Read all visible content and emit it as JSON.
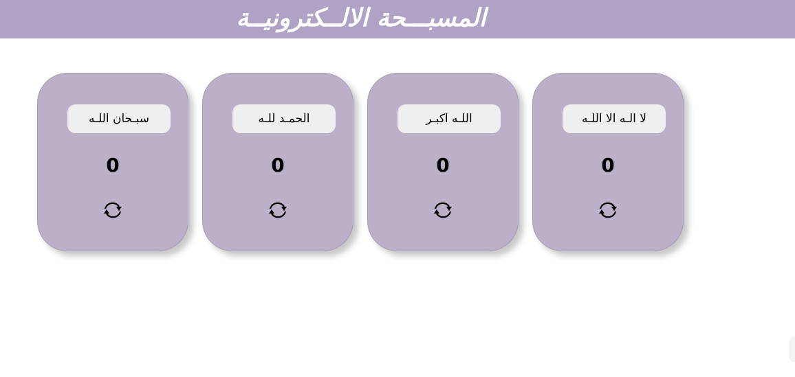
{
  "header": {
    "title": "المسبـــحة الالــكترونيــة"
  },
  "cards": [
    {
      "label": "سبـحان اللـه",
      "count": "0",
      "reset_icon": "refresh-icon"
    },
    {
      "label": "الحمـد للـه",
      "count": "0",
      "reset_icon": "refresh-icon"
    },
    {
      "label": "اللـه اكبـر",
      "count": "0",
      "reset_icon": "refresh-icon"
    },
    {
      "label": "لا الـه الا اللـه",
      "count": "0",
      "reset_icon": "refresh-icon"
    }
  ],
  "colors": {
    "header_bg": "#b0a2c4",
    "card_bg": "#bcb0c9",
    "button_bg": "#efefef"
  }
}
